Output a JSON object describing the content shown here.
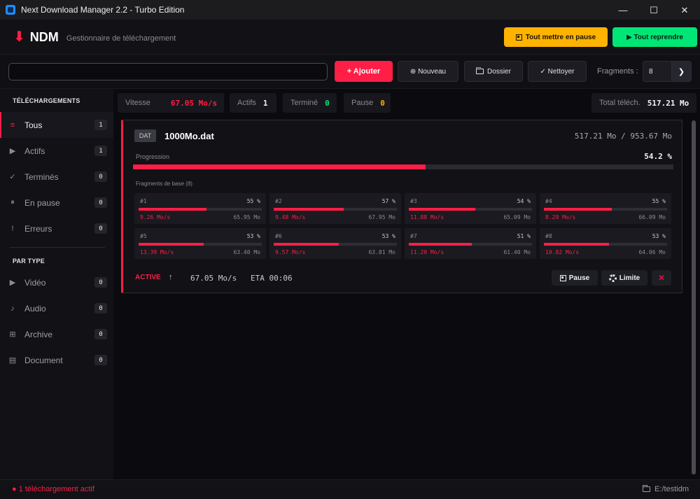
{
  "window": {
    "title": "Next Download Manager 2.2 - Turbo Edition",
    "min_icon": "minimize-icon",
    "max_icon": "maximize-icon",
    "close_icon": "close-icon"
  },
  "header": {
    "logo": "NDM",
    "subtitle": "Gestionnaire de téléchargement",
    "pause_all_label": "Tout mettre en pause",
    "resume_all_label": "▶ Tout reprendre"
  },
  "toolbar": {
    "url_value": "",
    "url_placeholder": "",
    "add_label": "+ Ajouter",
    "new_label": "⊕ Nouveau",
    "folder_label": "Dossier",
    "clean_label": "✓ Nettoyer",
    "fragments_label": "Fragments :",
    "fragments_value": "8"
  },
  "sidebar": {
    "downloads_title": "TÉLÉCHARGEMENTS",
    "items": [
      {
        "icon": "≡",
        "label": "Tous",
        "count": "1"
      },
      {
        "icon": "▶",
        "label": "Actifs",
        "count": "1"
      },
      {
        "icon": "✓",
        "label": "Terminés",
        "count": "0"
      },
      {
        "icon": "⏸",
        "label": "En pause",
        "count": "0"
      },
      {
        "icon": "!",
        "label": "Erreurs",
        "count": "0"
      }
    ],
    "type_title": "PAR TYPE",
    "types": [
      {
        "icon": "▶",
        "label": "Vidéo",
        "count": "0"
      },
      {
        "icon": "♪",
        "label": "Audio",
        "count": "0"
      },
      {
        "icon": "⊞",
        "label": "Archive",
        "count": "0"
      },
      {
        "icon": "▤",
        "label": "Document",
        "count": "0"
      }
    ]
  },
  "stats": {
    "speed_label": "Vitesse",
    "speed_value": "67.05 Mo/s",
    "active_label": "Actifs",
    "active_value": "1",
    "done_label": "Terminé",
    "done_value": "0",
    "pause_label": "Pause",
    "pause_value": "0",
    "total_label": "Total téléch.",
    "total_value": "517.21 Mo"
  },
  "download": {
    "type_badge": "DAT",
    "file_name": "1000Mo.dat",
    "size_text": "517.21 Mo / 953.67 Mo",
    "progress_label": "Progression",
    "progress_text": "54.2 %",
    "progress": 54.2,
    "fragments_title": "Fragments de base (8)",
    "fragments": [
      {
        "id": "#1",
        "pct": "55 %",
        "value": 55,
        "speed": "9.26 Mo/s",
        "size": "65.95 Mo"
      },
      {
        "id": "#2",
        "pct": "57 %",
        "value": 57,
        "speed": "9.48 Mo/s",
        "size": "67.95 Mo"
      },
      {
        "id": "#3",
        "pct": "54 %",
        "value": 54,
        "speed": "11.88 Mo/s",
        "size": "65.09 Mo"
      },
      {
        "id": "#4",
        "pct": "55 %",
        "value": 55,
        "speed": "8.29 Mo/s",
        "size": "66.09 Mo"
      },
      {
        "id": "#5",
        "pct": "53 %",
        "value": 53,
        "speed": "13.39 Mo/s",
        "size": "63.40 Mo"
      },
      {
        "id": "#6",
        "pct": "53 %",
        "value": 53,
        "speed": "9.57 Mo/s",
        "size": "63.81 Mo"
      },
      {
        "id": "#7",
        "pct": "51 %",
        "value": 51,
        "speed": "11.20 Mo/s",
        "size": "61.40 Mo"
      },
      {
        "id": "#8",
        "pct": "53 %",
        "value": 53,
        "speed": "10.82 Mo/s",
        "size": "64.06 Mo"
      }
    ],
    "status": "ACTIVE",
    "direction_icon": "↑",
    "speed": "67.05 Mo/s",
    "eta": "ETA 00:06",
    "pause_label": "Pause",
    "limit_label": "Limite",
    "cancel_label": "✕"
  },
  "footer": {
    "status": "● 1 téléchargement actif",
    "path": "E:/testidm"
  },
  "colors": {
    "accent": "#ff1e46",
    "warning": "#ffb300",
    "success": "#00e676"
  }
}
